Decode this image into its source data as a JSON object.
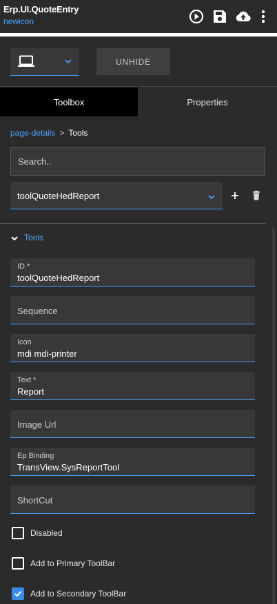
{
  "header": {
    "title": "Erp.UI.QuoteEntry",
    "subtitle": "newicon",
    "icons": [
      "play-circle-icon",
      "save-icon",
      "cloud-upload-icon",
      "more-vertical-icon"
    ]
  },
  "toolbar": {
    "device_icon": "laptop-icon",
    "unhide_label": "UNHIDE"
  },
  "tabs": [
    {
      "label": "Toolbox",
      "active": true
    },
    {
      "label": "Properties",
      "active": false
    }
  ],
  "breadcrumb": {
    "link": "page-details",
    "separator": ">",
    "current": "Tools"
  },
  "search": {
    "placeholder": "Search..",
    "value": ""
  },
  "tool_selector": {
    "value": "toolQuoteHedReport"
  },
  "section": {
    "title": "Tools"
  },
  "fields": {
    "id": {
      "label": "ID *",
      "value": "toolQuoteHedReport"
    },
    "sequence": {
      "label": "Sequence",
      "value": ""
    },
    "icon": {
      "label": "Icon",
      "value": "mdi mdi-printer"
    },
    "text": {
      "label": "Text *",
      "value": "Report"
    },
    "image_url": {
      "label": "Image Url",
      "value": ""
    },
    "ep_binding": {
      "label": "Ep Binding",
      "value": "TransView.SysReportTool"
    },
    "shortcut": {
      "label": "ShortCut",
      "value": ""
    }
  },
  "checkboxes": {
    "disabled": {
      "label": "Disabled",
      "checked": false
    },
    "primary": {
      "label": "Add to Primary ToolBar",
      "checked": false
    },
    "secondary": {
      "label": "Add to Secondary ToolBar",
      "checked": true
    }
  },
  "colors": {
    "accent": "#4da3ff",
    "background": "#2b2b2b",
    "field_bg": "#383838",
    "checkbox_checked": "#3a8be8"
  }
}
